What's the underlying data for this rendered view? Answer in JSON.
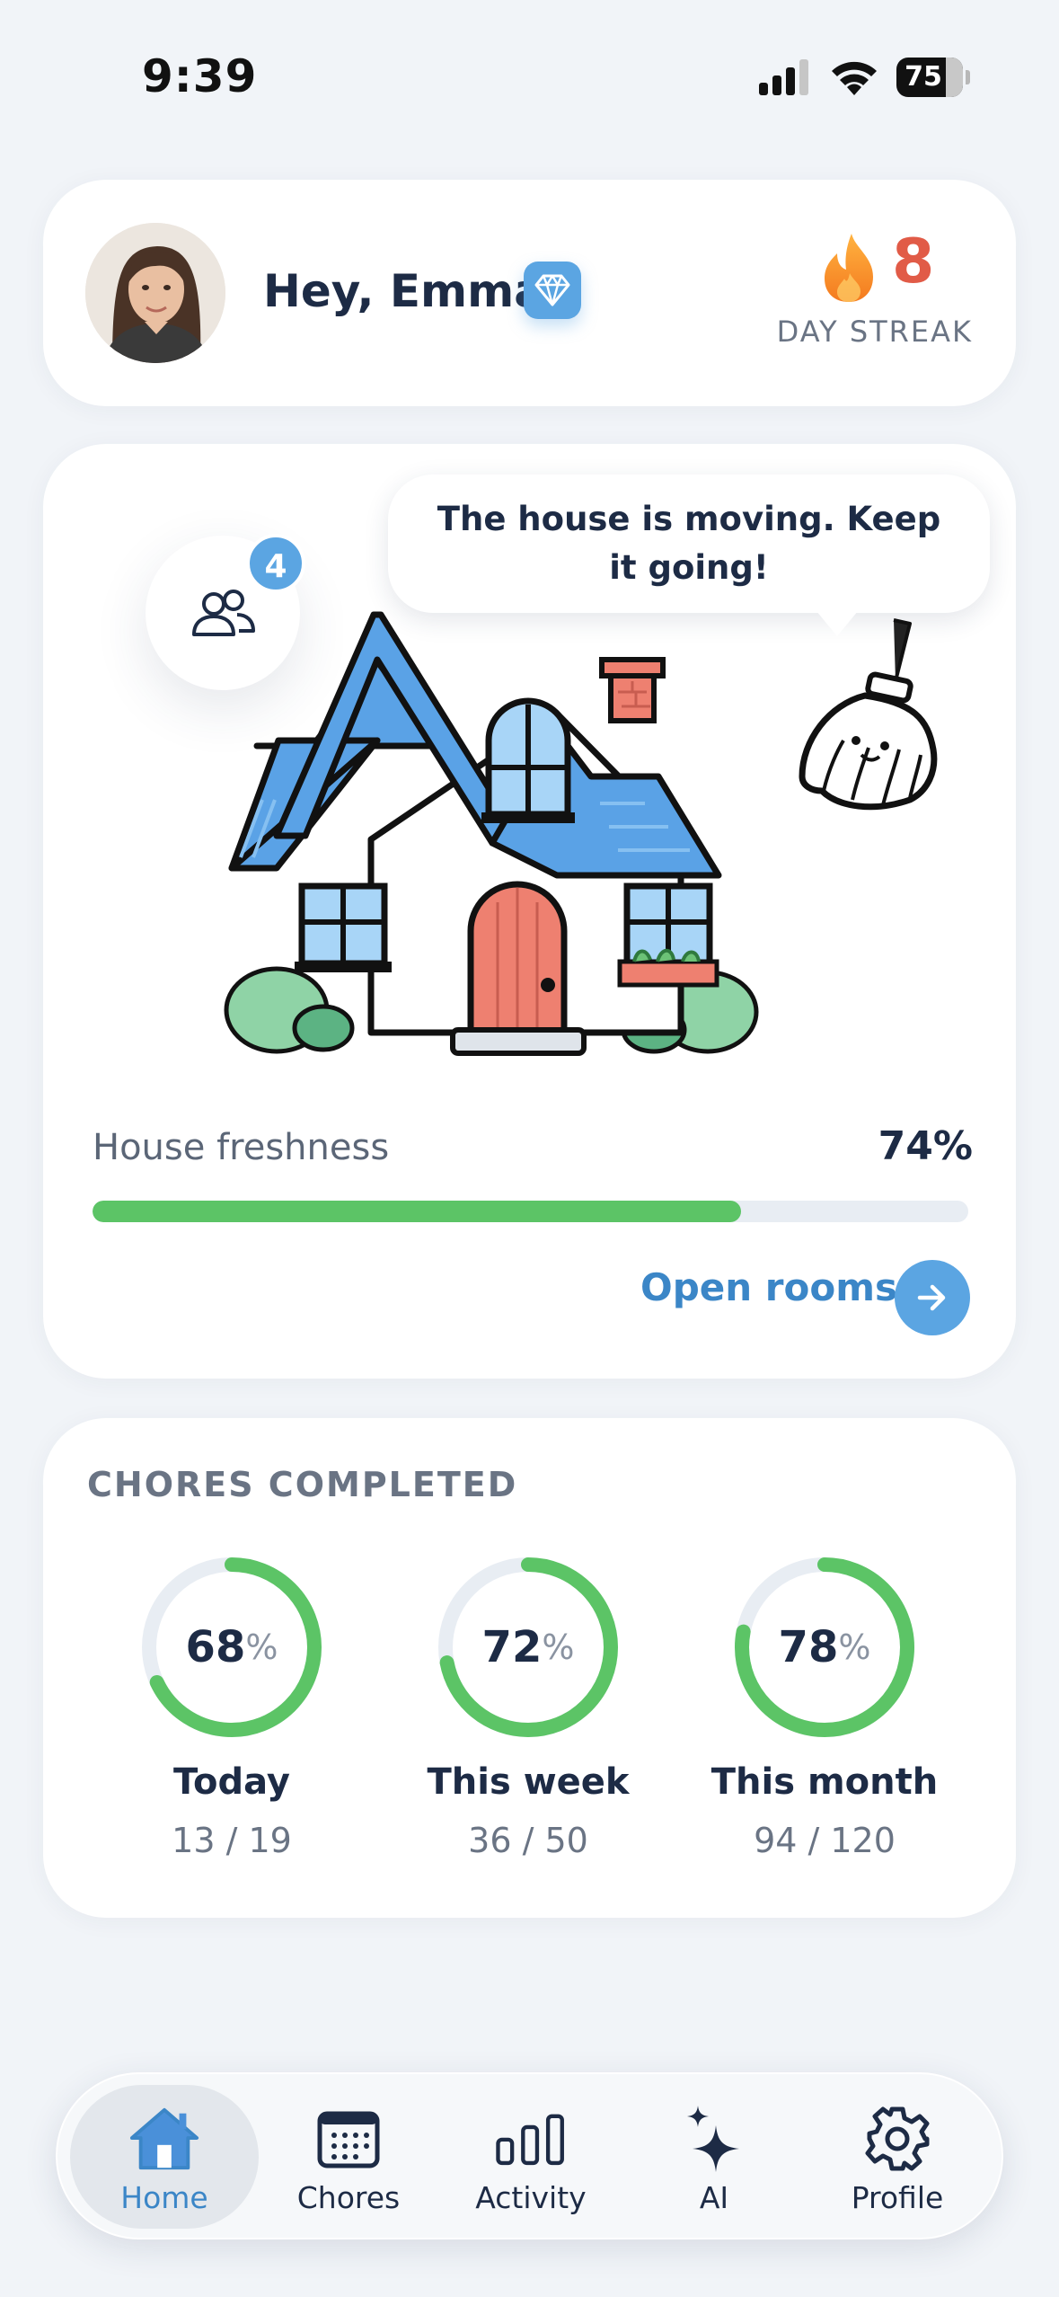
{
  "status_bar": {
    "time": "9:39",
    "battery": "75"
  },
  "header": {
    "greeting": "Hey, Emma",
    "streak_count": "8",
    "streak_label": "DAY STREAK"
  },
  "house": {
    "household_count": "4",
    "speech": "The house is moving. Keep it going!",
    "freshness_label": "House freshness",
    "freshness_value": "74%",
    "freshness_fraction": 0.74,
    "open_rooms_label": "Open rooms"
  },
  "chores": {
    "title": "CHORES COMPLETED",
    "items": [
      {
        "value": "68",
        "unit": "%",
        "fraction": 0.68,
        "label": "Today",
        "count": "13 / 19"
      },
      {
        "value": "72",
        "unit": "%",
        "fraction": 0.72,
        "label": "This week",
        "count": "36 / 50"
      },
      {
        "value": "78",
        "unit": "%",
        "fraction": 0.78,
        "label": "This month",
        "count": "94 / 120"
      }
    ]
  },
  "tabs": [
    {
      "label": "Home",
      "icon": "home-icon",
      "active": true
    },
    {
      "label": "Chores",
      "icon": "calendar-icon",
      "active": false
    },
    {
      "label": "Activity",
      "icon": "bar-chart-icon",
      "active": false
    },
    {
      "label": "AI",
      "icon": "sparkle-icon",
      "active": false
    },
    {
      "label": "Profile",
      "icon": "gear-icon",
      "active": false
    }
  ],
  "colors": {
    "accent": "#5ba5e2",
    "accent_text": "#3b86c7",
    "progress": "#5cc466",
    "streak": "#e15b47",
    "background": "#f1f4f8"
  }
}
